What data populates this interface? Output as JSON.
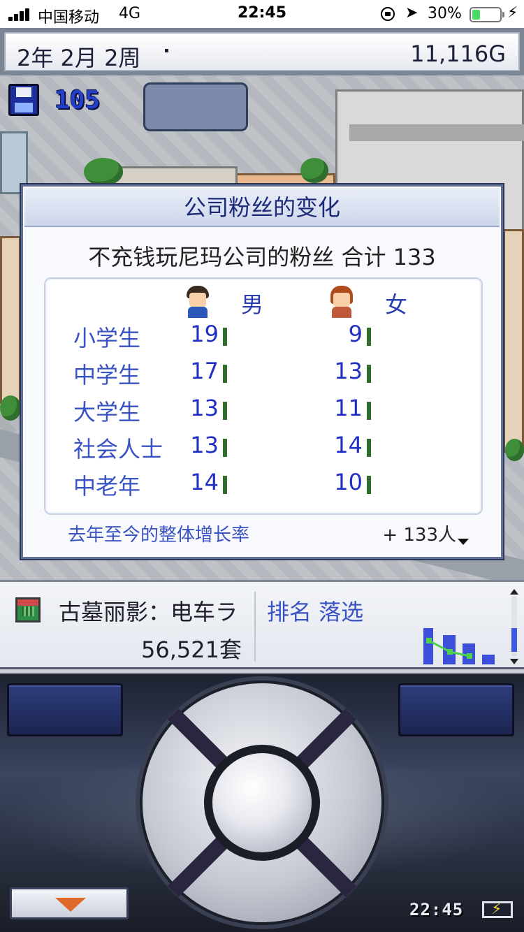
{
  "status_bar": {
    "carrier": "中国移动",
    "network": "4G",
    "time": "22:45",
    "battery_percent": "30%",
    "battery_level": 0.3,
    "icons": [
      "signal-icon",
      "lock-rotation-icon",
      "location-icon",
      "battery-icon",
      "charging-icon"
    ]
  },
  "header": {
    "date": "2年 2月 2周",
    "money": "11,116G"
  },
  "hud": {
    "save_count": "105",
    "save_icon": "floppy-disk-icon"
  },
  "fan_dialog": {
    "title": "公司粉丝的变化",
    "subtitle": "不充钱玩尼玛公司的粉丝 合计 133",
    "columns": {
      "male": "男",
      "female": "女"
    },
    "rows": [
      {
        "label": "小学生",
        "male": "19",
        "female": "9"
      },
      {
        "label": "中学生",
        "male": "17",
        "female": "13"
      },
      {
        "label": "大学生",
        "male": "13",
        "female": "11"
      },
      {
        "label": "社会人士",
        "male": "13",
        "female": "14"
      },
      {
        "label": "中老年",
        "male": "14",
        "female": "10"
      }
    ],
    "growth_label": "去年至今的整体增长率",
    "growth_value": "+ 133人"
  },
  "info_panel": {
    "game_name": "古墓丽影：电车ラ",
    "sales": "56,521套",
    "ranking": "排名 落选",
    "chart_colors": {
      "bars": "#3b4fd8",
      "line": "#4fd24a"
    }
  },
  "controller": {
    "clock": "22:45"
  },
  "colors": {
    "dialog_border": "#5f6f95",
    "label_blue": "#3a53c2",
    "value_blue": "#2130c4",
    "bar_green": "#2f6e2a",
    "menu_arrow": "#e0692a"
  }
}
